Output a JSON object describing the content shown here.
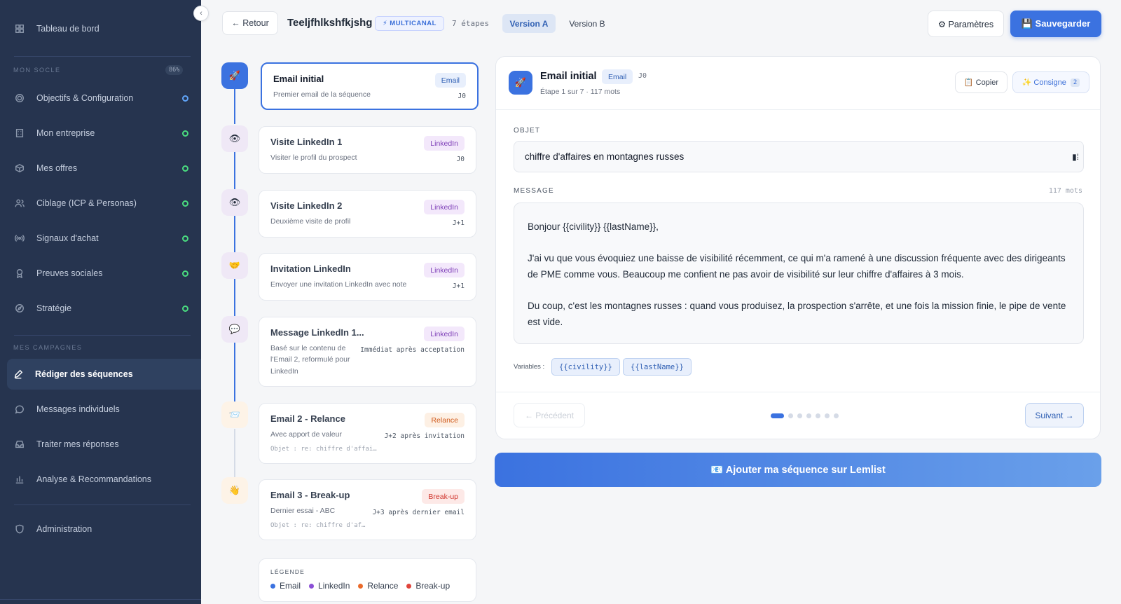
{
  "sidebar": {
    "top_item": "Tableau de bord",
    "section_socle": "MON SOCLE",
    "socle_progress": "86%",
    "socle_items": [
      {
        "label": "Objectifs & Configuration"
      },
      {
        "label": "Mon entreprise"
      },
      {
        "label": "Mes offres"
      },
      {
        "label": "Ciblage (ICP & Personas)"
      },
      {
        "label": "Signaux d'achat"
      },
      {
        "label": "Preuves sociales"
      },
      {
        "label": "Stratégie"
      }
    ],
    "section_campagnes": "MES CAMPAGNES",
    "campagne_items": [
      {
        "label": "Rédiger des séquences"
      },
      {
        "label": "Messages individuels"
      },
      {
        "label": "Traiter mes réponses"
      },
      {
        "label": "Analyse & Recommandations"
      }
    ],
    "admin_item": "Administration",
    "collapse_glyph": "‹"
  },
  "header": {
    "back_label": "← Retour",
    "sequence_name": "Teeljfhlkshfkjshg",
    "badge": "⚡ MULTICANAL",
    "steps_count": "7 étapes",
    "version_a": "Version A",
    "version_b": "Version B",
    "params_label": "⚙ Paramètres",
    "save_label": "💾 Sauvegarder"
  },
  "steps": [
    {
      "icon": "🚀",
      "title": "Email initial",
      "desc": "Premier email de la séquence",
      "tag": "Email",
      "timing": "J0",
      "object": ""
    },
    {
      "icon": "👁",
      "title": "Visite LinkedIn 1",
      "desc": "Visiter le profil du prospect",
      "tag": "LinkedIn",
      "timing": "J0",
      "object": ""
    },
    {
      "icon": "👁",
      "title": "Visite LinkedIn 2",
      "desc": "Deuxième visite de profil",
      "tag": "LinkedIn",
      "timing": "J+1",
      "object": ""
    },
    {
      "icon": "🤝",
      "title": "Invitation LinkedIn",
      "desc": "Envoyer une invitation LinkedIn avec note",
      "tag": "LinkedIn",
      "timing": "J+1",
      "object": ""
    },
    {
      "icon": "💬",
      "title": "Message LinkedIn 1...",
      "desc": "Basé sur le contenu de l'Email 2, reformulé pour LinkedIn",
      "tag": "LinkedIn",
      "timing": "Immédiat après acceptation",
      "object": ""
    },
    {
      "icon": "📨",
      "title": "Email 2 - Relance",
      "desc": "Avec apport de valeur",
      "tag": "Relance",
      "timing": "J+2 après invitation",
      "object": "Objet : re: chiffre d'affai…"
    },
    {
      "icon": "👋",
      "title": "Email 3 - Break-up",
      "desc": "Dernier essai - ABC",
      "tag": "Break-up",
      "timing": "J+3 après dernier email",
      "object": "Objet : re: chiffre d'af…"
    }
  ],
  "legend": {
    "title": "LÉGENDE",
    "items": [
      {
        "label": "Email",
        "color": "#3b72e0"
      },
      {
        "label": "LinkedIn",
        "color": "#8b4fd6"
      },
      {
        "label": "Relance",
        "color": "#ea6a2a"
      },
      {
        "label": "Break-up",
        "color": "#e0443b"
      }
    ]
  },
  "editor": {
    "icon": "🚀",
    "title": "Email initial",
    "tag": "Email",
    "timing": "J0",
    "subtitle": "Étape 1 sur 7 · 117 mots",
    "copy_label": "📋 Copier",
    "consigne_label": "✨ Consigne",
    "consigne_count": "2",
    "subject_label": "OBJET",
    "subject_value": "chiffre d'affaires en montagnes russes",
    "message_label": "MESSAGE",
    "word_count": "117 mots",
    "message_paragraphs": [
      "Bonjour {{civility}} {{lastName}},",
      "J'ai vu que vous évoquiez une baisse de visibilité récemment, ce qui m'a ramené à une discussion fréquente avec des dirigeants de PME comme vous. Beaucoup me confient ne pas avoir de visibilité sur leur chiffre d'affaires à 3 mois.",
      "Du coup, c'est les montagnes russes : quand vous produisez, la prospection s'arrête, et une fois la mission finie, le pipe de vente est vide."
    ],
    "variables_label": "Variables :",
    "variables": [
      "{{civility}}",
      "{{lastName}}"
    ],
    "prev_label": "← Précédent",
    "next_label": "Suivant →",
    "current_step": 1,
    "total_steps": 7
  },
  "lemlist_label": "📧 Ajouter ma séquence sur Lemlist"
}
